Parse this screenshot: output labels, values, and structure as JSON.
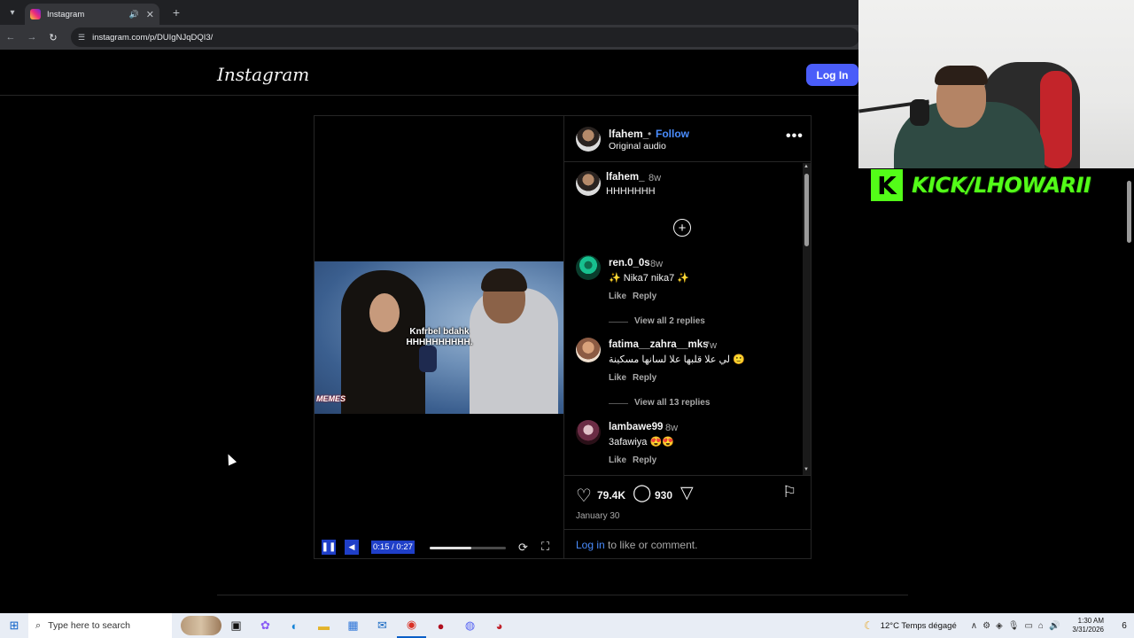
{
  "browser": {
    "tab_title": "Instagram",
    "new_tab_label": "+",
    "url": "instagram.com/p/DUIgNJqDQI3/"
  },
  "instagram": {
    "logo": "Instagram",
    "login_button": "Log In",
    "post": {
      "author": "lfahem_",
      "separator": "•",
      "follow": "Follow",
      "audio": "Original audio",
      "caption_user": "lfahem_",
      "caption_time": "8w",
      "caption_text": "HHHHHHH",
      "video": {
        "overlay_caption": "Knfrbel bdahk HHHHHHHHHH.",
        "watermark": "MEMES",
        "time": "0:15 / 0:27",
        "progress": 0.55
      },
      "comments": [
        {
          "user": "ren.0_0s",
          "time": "8w",
          "text": "✨ Nika7 nika7 ✨",
          "like": "Like",
          "reply": "Reply",
          "view_replies": "View all 2 replies"
        },
        {
          "user": "fatima__zahra__mks",
          "time": "7w",
          "text": "لي علا قلبها علا لسانها مسكينة 🙂",
          "like": "Like",
          "reply": "Reply",
          "view_replies": "View all 13 replies"
        },
        {
          "user": "lambawe99",
          "time": "8w",
          "text": "3afawiya 😍😍",
          "like": "Like",
          "reply": "Reply"
        }
      ],
      "likes": "79.4K",
      "comments_count": "930",
      "date": "January 30",
      "login_prompt_link": "Log in",
      "login_prompt_rest": " to like or comment."
    }
  },
  "stream_overlay": {
    "kick_label": "KICK/LHOWARII"
  },
  "taskbar": {
    "search_placeholder": "Type here to search",
    "weather": "12°C  Temps dégagé",
    "time": "1:30 AM",
    "date": "3/31/2026",
    "notifications": "6"
  },
  "colors": {
    "accent_blue": "#4a5df9",
    "link_blue": "#4a8dff",
    "kick_green": "#53fc18"
  }
}
